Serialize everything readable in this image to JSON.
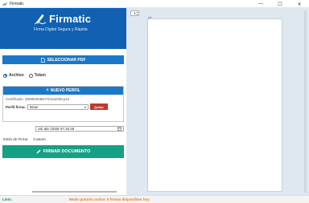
{
  "window": {
    "title": "Firmatic",
    "controls": {
      "minimize": "—",
      "maximize": "☐",
      "close": "✕"
    }
  },
  "header": {
    "brand": "Firmatic",
    "tagline": "Firma Digital Segura y Rápida"
  },
  "actions": {
    "select_pdf": "SELECCIONAR PDF",
    "new_profile": "NUEVO PERFIL",
    "sign_document": "FIRMAR DOCUMENTO",
    "remove_profile": "Quitar"
  },
  "source": {
    "options": [
      "Archivo",
      "Token"
    ],
    "selected": "Archivo"
  },
  "profile": {
    "certificate": "Certificado: 25006I2068-Firma2026.p12",
    "label": "Perfil firma:",
    "selected": "Brian"
  },
  "date": {
    "value": "15/ abr /2026 07:15:45"
  },
  "style": {
    "label": "Estilo de Firma:",
    "value": "Custom"
  },
  "viewer": {
    "page_number": "1",
    "page_marker": "p1"
  },
  "status": {
    "left": "Listo.",
    "right": "Modo gratuito activo: 5 firmas disponibles hoy"
  },
  "colors": {
    "brand_blue": "#1160b1",
    "button_blue": "#1b78c9",
    "sign_teal": "#16a085",
    "danger_red": "#c0392b",
    "status_green": "#1a8a4a",
    "status_orange": "#e67e22"
  }
}
